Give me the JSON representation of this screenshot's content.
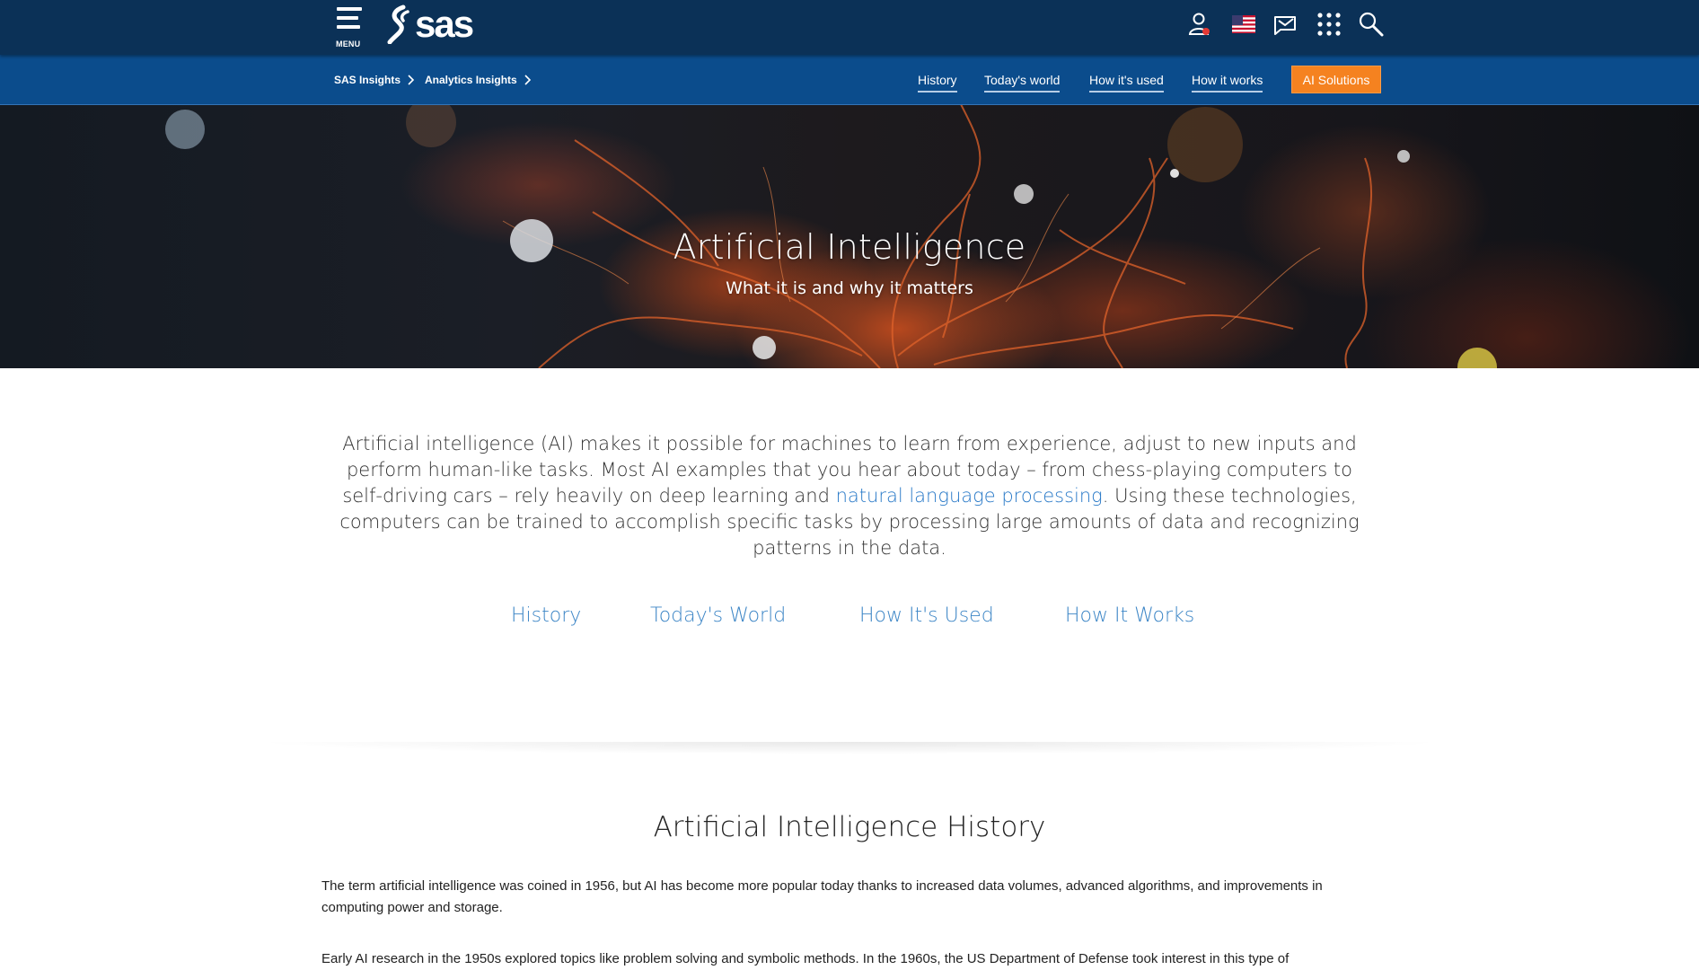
{
  "header": {
    "menu_label": "MENU",
    "logo_text": "sas",
    "icons": [
      "user-icon",
      "us-flag-icon",
      "contact-icon",
      "apps-grid-icon",
      "search-icon"
    ]
  },
  "breadcrumb": {
    "items": [
      "SAS Insights",
      "Analytics Insights"
    ]
  },
  "subnav": {
    "links": [
      "History",
      "Today's world",
      "How it's used",
      "How it works"
    ],
    "cta_label": "AI Solutions"
  },
  "hero": {
    "title": "Artificial Intelligence",
    "subtitle": "What it is and why it matters"
  },
  "intro": {
    "text_before": "Artificial intelligence (AI) makes it possible for machines to learn from experience, adjust to new inputs and perform human-like tasks. Most AI examples that you hear about today – from chess-playing computers to self-driving cars – rely heavily on deep learning and ",
    "link_text": "natural language processing",
    "text_after": ". Using these technologies, computers can be trained to accomplish specific tasks by processing large amounts of data and recognizing patterns in the data."
  },
  "jump_links": [
    "History",
    "Today's World",
    "How It's Used",
    "How It Works"
  ],
  "history": {
    "title": "Artificial Intelligence History",
    "paragraphs": [
      "The term artificial intelligence was coined in 1956, but AI has become more popular today thanks to increased data volumes, advanced algorithms, and improvements in computing power and storage.",
      "Early AI research in the 1950s explored topics like problem solving and symbolic methods. In the 1960s, the US Department of Defense took interest in this type of"
    ]
  },
  "colors": {
    "topbar": "#0b3157",
    "subbar": "#0b4c8c",
    "cta": "#f58220",
    "link": "#3d86c6"
  }
}
